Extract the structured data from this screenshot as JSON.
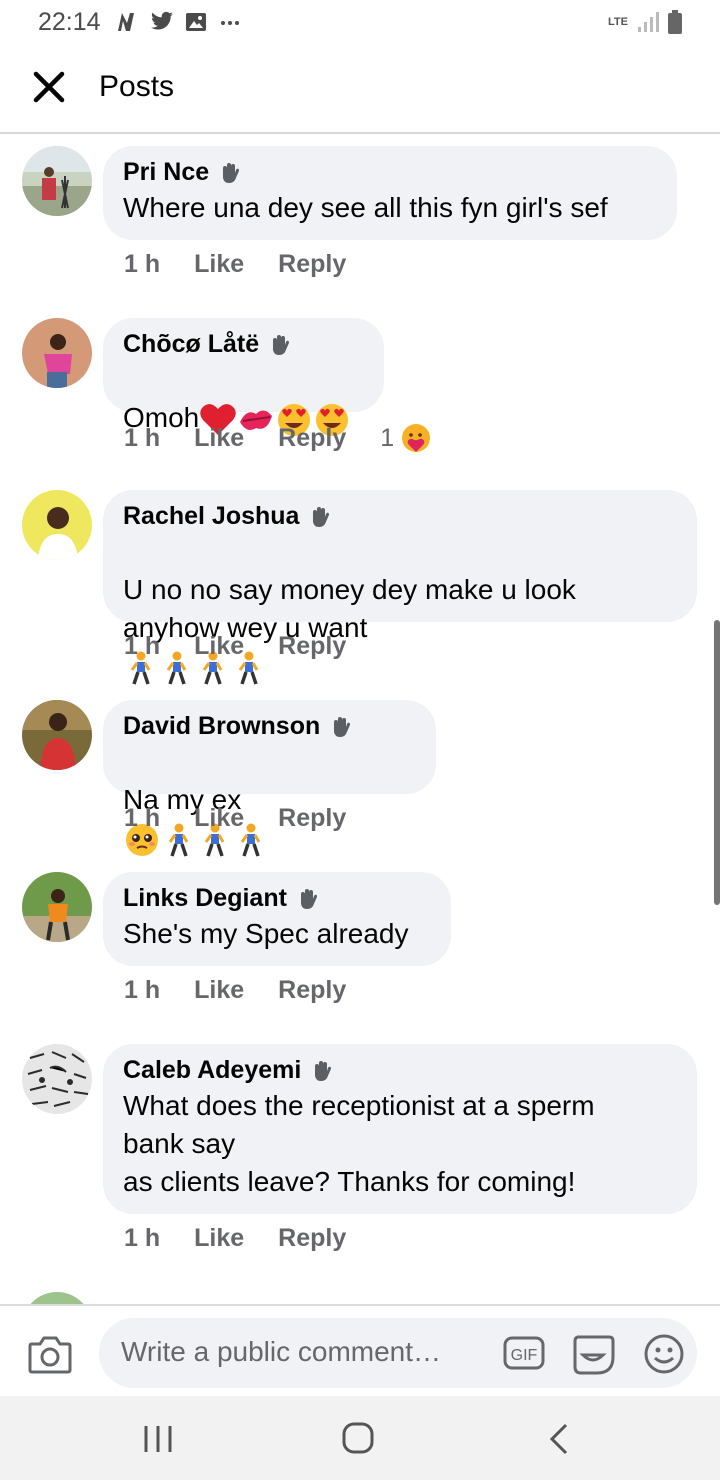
{
  "status_bar": {
    "time": "22:14",
    "network": "LTE"
  },
  "header": {
    "title": "Posts"
  },
  "comments": [
    {
      "author": "Pri Nce",
      "text": "Where una dey see all this fyn girl's sef",
      "time": "1 h",
      "like": "Like",
      "reply": "Reply",
      "emojis": []
    },
    {
      "author": "Chõcø Låtë",
      "text": "Omoh",
      "time": "1 h",
      "like": "Like",
      "reply": "Reply",
      "reaction_count": "1",
      "emojis": [
        "heart",
        "kiss-mark",
        "heart-eyes",
        "heart-eyes"
      ]
    },
    {
      "author": "Rachel Joshua",
      "text": "U no no say money dey make u look\nanyhow wey u want",
      "time": "1 h",
      "like": "Like",
      "reply": "Reply",
      "emojis": [
        "walking-person",
        "walking-person",
        "walking-person",
        "walking-person"
      ]
    },
    {
      "author": "David Brownson",
      "text": "Na my ex",
      "time": "1 h",
      "like": "Like",
      "reply": "Reply",
      "emojis": [
        "pleading-face",
        "walking-person",
        "walking-person",
        "walking-person"
      ]
    },
    {
      "author": "Links Degiant",
      "text": "She's my Spec already",
      "time": "1 h",
      "like": "Like",
      "reply": "Reply",
      "emojis": []
    },
    {
      "author": "Caleb Adeyemi",
      "text": "What does the receptionist at a sperm\nbank say\nas clients leave? Thanks for coming!",
      "time": "1 h",
      "like": "Like",
      "reply": "Reply",
      "emojis": []
    }
  ],
  "composer": {
    "placeholder": "Write a public comment…",
    "gif_label": "GIF"
  },
  "colors": {
    "bubble": "#f0f2f5",
    "meta": "#65676b",
    "text": "#050505"
  }
}
